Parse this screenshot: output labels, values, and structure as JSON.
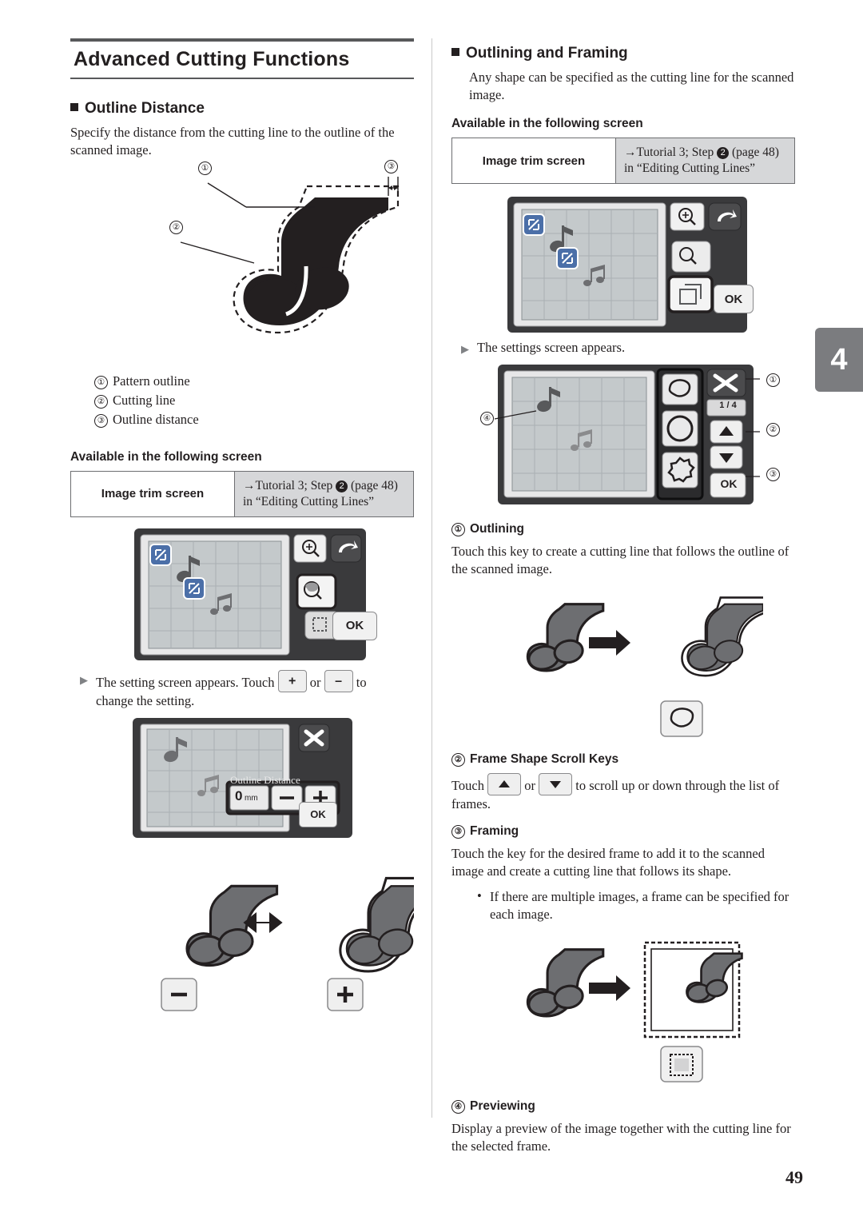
{
  "page": {
    "number": "49",
    "chapter_tab": "4"
  },
  "left": {
    "title": "Advanced Cutting Functions",
    "section1": {
      "heading": "Outline Distance",
      "body": "Specify the distance from the cutting line to the outline of the scanned image.",
      "figure_callouts": [
        "1",
        "2",
        "3"
      ],
      "legend": [
        {
          "num": "a",
          "label": "Pattern outline"
        },
        {
          "num": "b",
          "label": "Cutting line"
        },
        {
          "num": "c",
          "label": "Outline distance"
        }
      ],
      "available_heading": "Available in the following screen",
      "available_table": {
        "left": "Image trim screen",
        "right_line1_prefix": "→Tutorial 3; Step",
        "right_step": "2",
        "right_line1_suffix": "(page 48)",
        "right_line2": "in “Editing Cutting Lines”"
      },
      "note": "The setting screen appears. Touch        or        to change the setting.",
      "note_part1": "The setting screen appears. Touch",
      "note_or": "or",
      "note_part2": "to",
      "note_part3": "change the setting.",
      "screen_ok": "OK",
      "screen_label": "Outline Distance",
      "screen_value": "0",
      "screen_unit": "mm"
    }
  },
  "right": {
    "section2": {
      "heading": "Outlining and Framing",
      "body": "Any shape can be specified as the cutting line for the scanned image.",
      "available_heading": "Available in the following screen",
      "available_table": {
        "left": "Image trim screen",
        "right_line1_prefix": "→Tutorial 3; Step",
        "right_step": "2",
        "right_line1_suffix": "(page 48)",
        "right_line2": "in “Editing Cutting Lines”"
      },
      "note1": "The settings screen appears.",
      "screen_ok": "OK",
      "screen_counter": "1 / 4",
      "callouts": [
        "1",
        "2",
        "3",
        "4"
      ],
      "items": [
        {
          "num": "a",
          "title": "Outlining",
          "body": "Touch this key to create a cutting line that follows the outline of the scanned image."
        },
        {
          "num": "b",
          "title": "Frame Shape Scroll Keys",
          "body_part1": "Touch",
          "body_or": "or",
          "body_part2": "to scroll up or down through the list of frames."
        },
        {
          "num": "c",
          "title": "Framing",
          "body": "Touch the key for the desired frame to add it to the scanned image and create a cutting line that follows its shape.",
          "bullet": "If there are multiple images, a frame can be specified for each image."
        },
        {
          "num": "d",
          "title": "Previewing",
          "body": "Display a preview of the image together with the cutting line for the selected frame."
        }
      ]
    }
  },
  "colors": {
    "ink": "#231f20",
    "rule": "#58595b",
    "table_fill": "#d6d7d9",
    "lcd_body": "#3a3a3c",
    "tab_gray": "#7b7c7f"
  }
}
